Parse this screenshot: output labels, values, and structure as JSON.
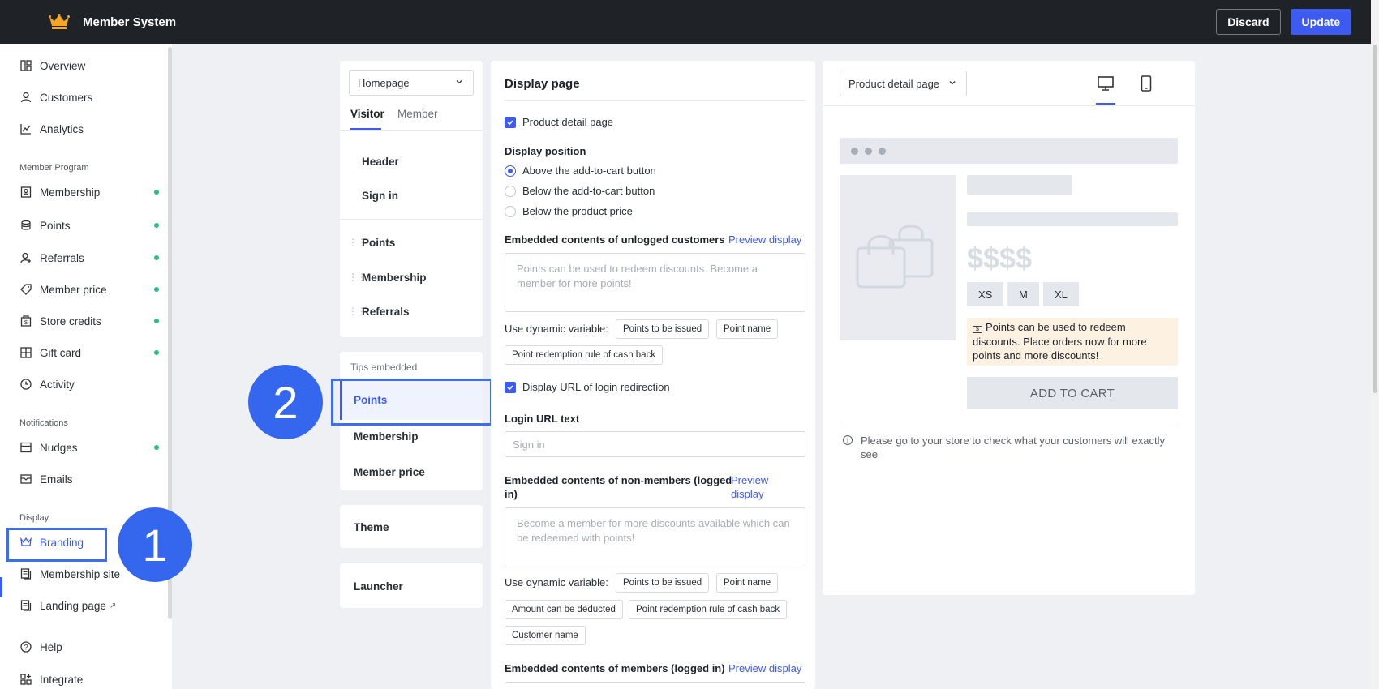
{
  "app": {
    "title": "Member System"
  },
  "header": {
    "discard_label": "Discard",
    "update_label": "Update"
  },
  "sidebar": {
    "items": [
      {
        "label": "Overview"
      },
      {
        "label": "Customers"
      },
      {
        "label": "Analytics"
      },
      {
        "label": "Membership"
      },
      {
        "label": "Points"
      },
      {
        "label": "Referrals"
      },
      {
        "label": "Member price"
      },
      {
        "label": "Store credits"
      },
      {
        "label": "Gift card"
      },
      {
        "label": "Activity"
      },
      {
        "label": "Nudges"
      },
      {
        "label": "Emails"
      },
      {
        "label": "Branding"
      },
      {
        "label": "Membership site"
      },
      {
        "label": "Landing page"
      },
      {
        "label": "Help"
      },
      {
        "label": "Integrate"
      }
    ],
    "sections": {
      "member_program": "Member Program",
      "notifications": "Notifications",
      "display": "Display"
    },
    "status_color": "#27c07d"
  },
  "annotations": {
    "badge_1": "1",
    "badge_2": "2"
  },
  "nav_panel": {
    "page_select": "Homepage",
    "tabs": {
      "visitor": "Visitor",
      "member": "Member"
    },
    "links": {
      "header": "Header",
      "sign_in": "Sign in",
      "points": "Points",
      "membership": "Membership",
      "referrals": "Referrals"
    },
    "tips_embedded": {
      "title": "Tips embedded",
      "points": "Points",
      "membership": "Membership",
      "member_price": "Member price"
    },
    "theme": "Theme",
    "launcher": "Launcher"
  },
  "form": {
    "title": "Display page",
    "product_detail_checkbox": "Product detail page",
    "display_position_label": "Display position",
    "positions": {
      "above": "Above the add-to-cart button",
      "below": "Below the add-to-cart button",
      "price": "Below the product price"
    },
    "unlogged": {
      "label": "Embedded contents of unlogged customers",
      "preview": "Preview display",
      "placeholder": "Points can be used to redeem discounts. Become a member for more points!"
    },
    "dynamic_var_label": "Use dynamic variable:",
    "vars1": {
      "points_issued": "Points to be issued",
      "point_name": "Point name",
      "redemption_rule": "Point redemption rule of cash back"
    },
    "login_redirect_checkbox": "Display URL of login redirection",
    "login_url_label": "Login URL text",
    "login_url_placeholder": "Sign in",
    "non_members": {
      "label_line1": "Embedded contents of non-members (logged",
      "label_line2": "in)",
      "preview_line1": "Preview",
      "preview_line2": "display",
      "placeholder": "Become a member for more discounts available which can be redeemed with points!"
    },
    "vars2": {
      "points_issued": "Points to be issued",
      "point_name": "Point name",
      "amount_deducted": "Amount can be deducted",
      "redemption_rule": "Point redemption rule of cash back",
      "customer_name": "Customer name"
    },
    "members": {
      "label": "Embedded contents of members (logged in)",
      "preview": "Preview display"
    }
  },
  "preview": {
    "page_select": "Product detail page",
    "price": "$$$$",
    "sizes": [
      "XS",
      "M",
      "XL"
    ],
    "tip_text": "Points can be used to redeem discounts. Place orders now for more points and more discounts!",
    "tip_icon_text": "$",
    "add_to_cart": "ADD TO CART",
    "notice": "Please go to your store to check what your customers will exactly see",
    "accent_color": "#3d5af1"
  }
}
